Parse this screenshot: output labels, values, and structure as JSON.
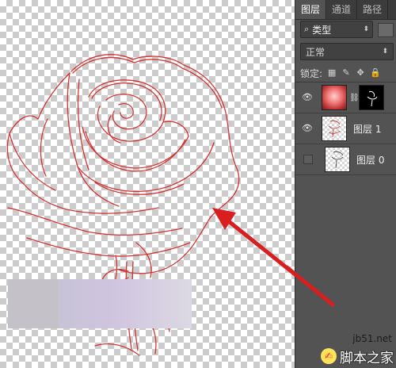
{
  "tabs": [
    "图层",
    "通道",
    "路径"
  ],
  "filter": {
    "label": "类型",
    "icon": "search-icon"
  },
  "blend_mode": "正常",
  "lock_label": "锁定:",
  "layers": [
    {
      "name": "",
      "visible": true,
      "thumb": "rose-photo",
      "has_mask": true
    },
    {
      "name": "图层 1",
      "visible": true,
      "thumb": "sketch-red"
    },
    {
      "name": "图层 0",
      "visible": false,
      "thumb": "sketch-black"
    }
  ],
  "watermark": {
    "url": "jb51.net",
    "text": "脚本之家"
  },
  "colors": {
    "sketch_line": "#d22020",
    "arrow": "#d81e1e",
    "panel_bg": "#535353",
    "tabbar_bg": "#3c3c3c"
  }
}
